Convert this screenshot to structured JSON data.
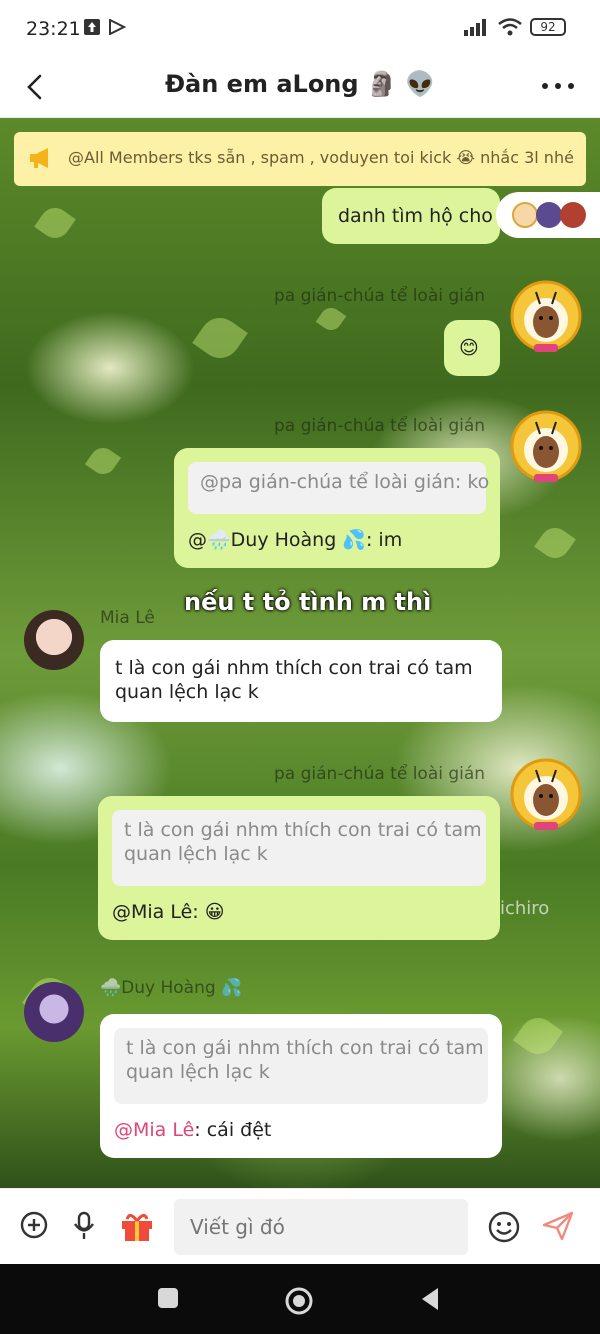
{
  "status": {
    "time": "23:21",
    "battery": "92"
  },
  "header": {
    "title": "Đàn em aLong 🗿 👽"
  },
  "announcement": {
    "text": "@All Members tks sẵn , spam , voduyen toi kick 😭 nhắc 3l nhé"
  },
  "messages": [
    {
      "side": "right",
      "text": "danh tìm hộ cho"
    },
    {
      "side": "right",
      "sender": "pa gián-chúa tể loài gián",
      "text": "😊"
    },
    {
      "side": "right",
      "sender": "pa gián-chúa tể loài gián",
      "quote": "@pa gián-chúa tể loài gián: ko",
      "reply_prefix": "@🌧️Duy Hoàng 💦",
      "reply_suffix": ": im"
    },
    {
      "side": "left",
      "sender": "Mia Lê",
      "text_line1": "t là con gái nhm thích con trai có tam",
      "text_line2": "quan lệch lạc k"
    },
    {
      "side": "right",
      "sender": "pa gián-chúa tể loài gián",
      "quote_line1": "t là con gái nhm thích con trai có tam",
      "quote_line2": "quan lệch lạc k",
      "reply_prefix": "@Mia Lê",
      "reply_suffix": ": 😀"
    },
    {
      "side": "left",
      "sender": "🌧️Duy Hoàng 💦",
      "quote_line1": "t là con gái nhm thích con trai có tam",
      "quote_line2": "quan lệch lạc k",
      "reply_prefix": "@Mia Lê",
      "reply_suffix": ": cái đệt"
    }
  ],
  "overlay": {
    "caption": "nếu t tỏ tình m thì",
    "watermark": "ichiro"
  },
  "input": {
    "placeholder": "Viết gì đó"
  },
  "colors": {
    "bubble_green": "#dcf59a",
    "announce_bg": "#fdf1a8",
    "mention": "#e0447a",
    "send": "#f08a80"
  }
}
